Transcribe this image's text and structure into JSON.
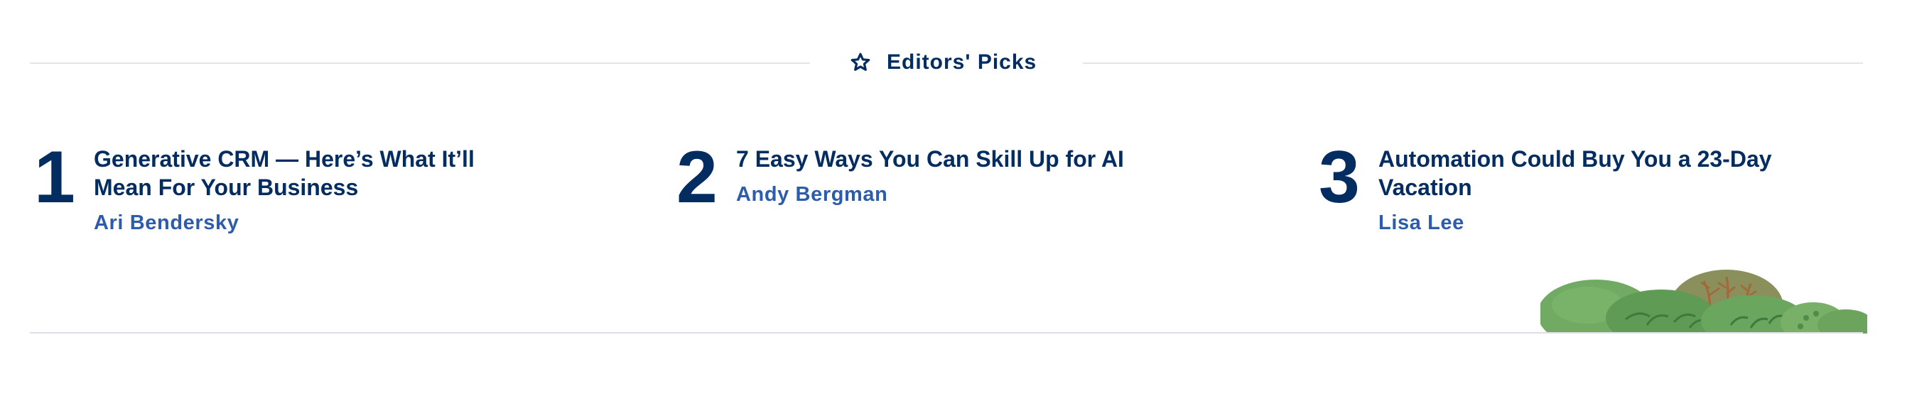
{
  "section": {
    "title": "Editors' Picks",
    "title_icon": "star-outline-icon"
  },
  "picks": [
    {
      "rank": "1",
      "headline_line1": "Generative CRM — Here’s What It’ll",
      "headline_line2": "Mean For Your Business",
      "author": "Ari Bendersky"
    },
    {
      "rank": "2",
      "headline_line1": "7 Easy Ways You Can Skill Up for AI",
      "headline_line2": "",
      "author": "Andy Bergman"
    },
    {
      "rank": "3",
      "headline_line1": "Automation Could Buy You a 23-Day",
      "headline_line2": "Vacation",
      "author": "Lisa Lee"
    }
  ],
  "colors": {
    "navy": "#032d60",
    "author_blue": "#2c5cab",
    "rule": "#e2e4e8",
    "bush_green": "#6fa85e",
    "bush_dark": "#8a8a5a"
  },
  "decoration": "bushes-illustration"
}
